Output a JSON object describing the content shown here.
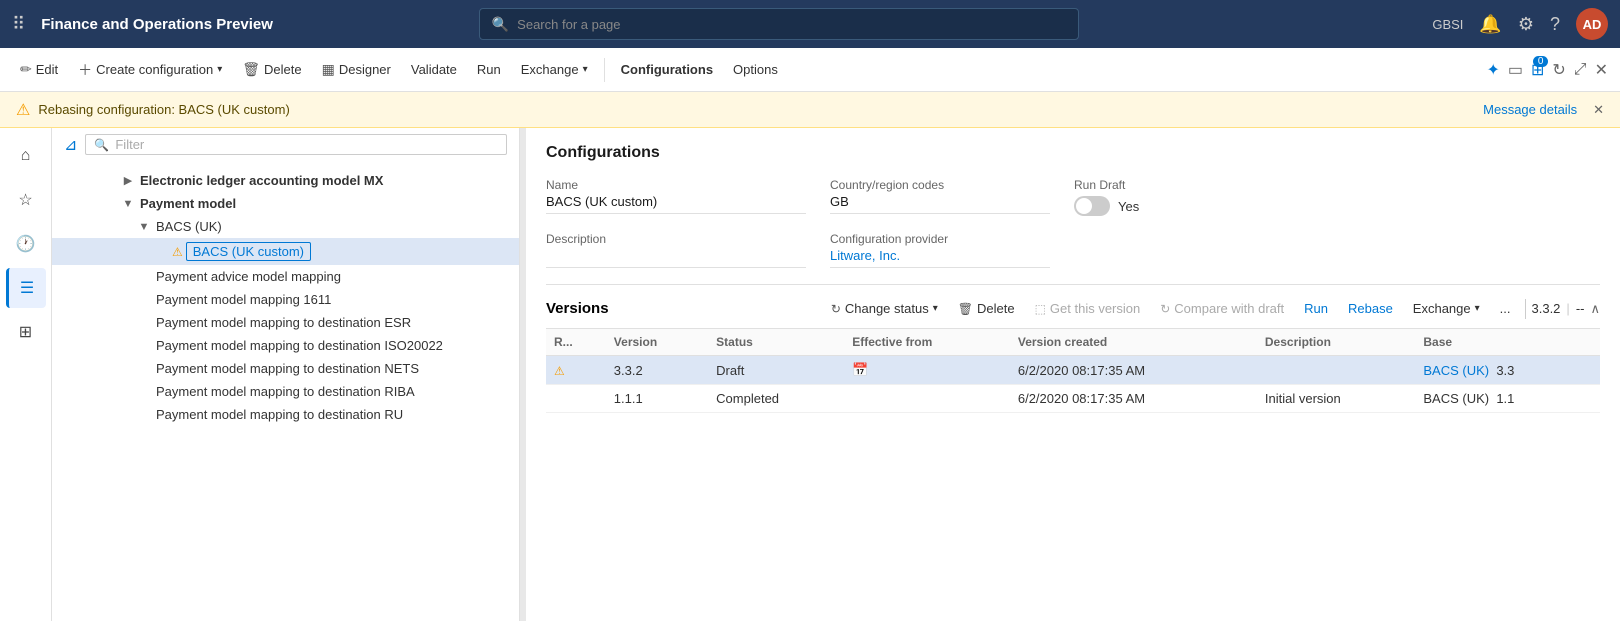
{
  "app": {
    "title": "Finance and Operations Preview"
  },
  "topnav": {
    "search_placeholder": "Search for a page",
    "user_initials": "AD",
    "tenant": "GBSI"
  },
  "toolbar": {
    "edit_label": "Edit",
    "create_label": "Create configuration",
    "delete_label": "Delete",
    "designer_label": "Designer",
    "validate_label": "Validate",
    "run_label": "Run",
    "exchange_label": "Exchange",
    "configurations_label": "Configurations",
    "options_label": "Options"
  },
  "warning": {
    "message": "Rebasing configuration: BACS (UK custom)",
    "details_link": "Message details"
  },
  "filter": {
    "placeholder": "Filter"
  },
  "tree": {
    "items": [
      {
        "id": "elec-ledger",
        "label": "Electronic ledger accounting model MX",
        "indent": 0,
        "chevron": "▶",
        "bold": true,
        "collapsed": true
      },
      {
        "id": "payment-model",
        "label": "Payment model",
        "indent": 0,
        "chevron": "▼",
        "bold": true,
        "collapsed": false
      },
      {
        "id": "bacs-uk",
        "label": "BACS (UK)",
        "indent": 1,
        "chevron": "▼",
        "bold": false,
        "collapsed": false
      },
      {
        "id": "bacs-uk-custom",
        "label": "BACS (UK custom)",
        "indent": 2,
        "chevron": "",
        "bold": false,
        "collapsed": false,
        "selected": true,
        "warn": true
      },
      {
        "id": "payment-advice",
        "label": "Payment advice model mapping",
        "indent": 1,
        "chevron": "",
        "bold": false
      },
      {
        "id": "payment-mapping-1611",
        "label": "Payment model mapping 1611",
        "indent": 1,
        "chevron": "",
        "bold": false
      },
      {
        "id": "payment-mapping-esr",
        "label": "Payment model mapping to destination ESR",
        "indent": 1,
        "chevron": "",
        "bold": false
      },
      {
        "id": "payment-mapping-iso",
        "label": "Payment model mapping to destination ISO20022",
        "indent": 1,
        "chevron": "",
        "bold": false
      },
      {
        "id": "payment-mapping-nets",
        "label": "Payment model mapping to destination NETS",
        "indent": 1,
        "chevron": "",
        "bold": false
      },
      {
        "id": "payment-mapping-riba",
        "label": "Payment model mapping to destination RIBA",
        "indent": 1,
        "chevron": "",
        "bold": false
      },
      {
        "id": "payment-mapping-ru",
        "label": "Payment model mapping to destination RU",
        "indent": 1,
        "chevron": "",
        "bold": false
      }
    ]
  },
  "configurations": {
    "section_title": "Configurations",
    "name_label": "Name",
    "name_value": "BACS (UK custom)",
    "country_label": "Country/region codes",
    "country_value": "GB",
    "run_draft_label": "Run Draft",
    "run_draft_value": "Yes",
    "description_label": "Description",
    "description_value": "",
    "provider_label": "Configuration provider",
    "provider_value": "Litware, Inc."
  },
  "versions": {
    "section_title": "Versions",
    "version_display": "3.3.2",
    "version_sep": "--",
    "actions": {
      "change_status": "Change status",
      "delete": "Delete",
      "get_this_version": "Get this version",
      "compare_with_draft": "Compare with draft",
      "run": "Run",
      "rebase": "Rebase",
      "exchange": "Exchange",
      "more": "..."
    },
    "table": {
      "columns": [
        "R...",
        "Version",
        "Status",
        "Effective from",
        "Version created",
        "Description",
        "Base"
      ],
      "rows": [
        {
          "warn": true,
          "version": "3.3.2",
          "status": "Draft",
          "effective_from": "",
          "version_created": "6/2/2020 08:17:35 AM",
          "description": "",
          "base": "BACS (UK)",
          "base_version": "3.3",
          "base_is_link": true,
          "selected": true
        },
        {
          "warn": false,
          "version": "1.1.1",
          "status": "Completed",
          "effective_from": "",
          "version_created": "6/2/2020 08:17:35 AM",
          "description": "Initial version",
          "base": "BACS (UK)",
          "base_version": "1.1",
          "base_is_link": false,
          "selected": false
        }
      ]
    }
  }
}
